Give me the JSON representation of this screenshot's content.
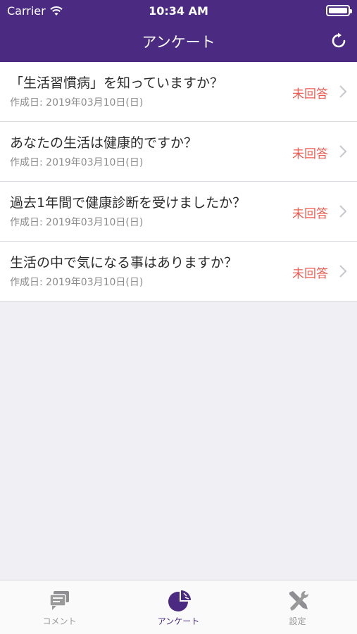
{
  "status_bar": {
    "carrier": "Carrier",
    "time": "10:34 AM"
  },
  "navbar": {
    "title": "アンケート",
    "refresh_icon": "refresh-icon",
    "bg_color": "#4b2a82"
  },
  "surveys": [
    {
      "title": "「生活習慣病」を知っていますか？",
      "date": "作成日: 2019年03月10日(日)",
      "status": "未回答"
    },
    {
      "title": "あなたの生活は健康的ですか？",
      "date": "作成日: 2019年03月10日(日)",
      "status": "未回答"
    },
    {
      "title": "過去1年間で健康診断を受けましたか？",
      "date": "作成日: 2019年03月10日(日)",
      "status": "未回答"
    },
    {
      "title": "生活の中で気になる事はありますか？",
      "date": "作成日: 2019年03月10日(日)",
      "status": "未回答"
    }
  ],
  "status_color": "#ee5a4f",
  "tabbar": {
    "tabs": [
      {
        "label": "コメント",
        "icon": "comment-icon",
        "active": false
      },
      {
        "label": "アンケート",
        "icon": "pie-chart-icon",
        "active": true
      },
      {
        "label": "設定",
        "icon": "tools-icon",
        "active": false
      }
    ],
    "active_color": "#4b2a82",
    "inactive_color": "#9a9a9a"
  }
}
